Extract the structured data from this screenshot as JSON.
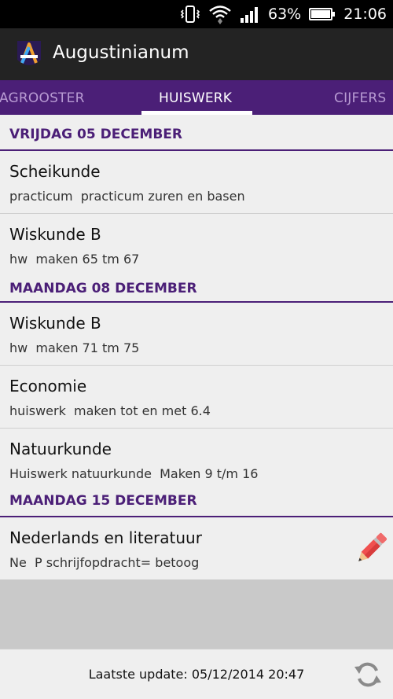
{
  "status": {
    "battery_percent": "63%",
    "time": "21:06",
    "icons": [
      "vibrate-icon",
      "wifi-icon",
      "signal-icon",
      "battery-icon"
    ]
  },
  "app": {
    "title": "Augustinianum",
    "logo": "augustinianum-logo",
    "accent_color": "#4b1f77"
  },
  "tabs": [
    {
      "label": "DAGROOSTER",
      "active": false
    },
    {
      "label": "HUISWERK",
      "active": true
    },
    {
      "label": "CIJFERS",
      "active": false
    }
  ],
  "sections": [
    {
      "header": "VRIJDAG 05 DECEMBER",
      "items": [
        {
          "title": "Scheikunde",
          "subtitle": "practicum  practicum zuren en basen"
        },
        {
          "title": "Wiskunde B",
          "subtitle": "hw  maken 65 tm 67"
        }
      ]
    },
    {
      "header": "MAANDAG 08 DECEMBER",
      "items": [
        {
          "title": "Wiskunde B",
          "subtitle": "hw  maken 71 tm 75"
        },
        {
          "title": "Economie",
          "subtitle": "huiswerk  maken tot en met 6.4"
        },
        {
          "title": "Natuurkunde",
          "subtitle": "Huiswerk natuurkunde  Maken 9 t/m 16"
        }
      ]
    },
    {
      "header": "MAANDAG 15 DECEMBER",
      "items": [
        {
          "title": "Nederlands en literatuur",
          "subtitle": "Ne  P schrijfopdracht= betoog",
          "icon": "pencil-icon"
        }
      ]
    }
  ],
  "footer": {
    "last_update": "Laatste update: 05/12/2014 20:47",
    "refresh_icon": "refresh-icon"
  }
}
